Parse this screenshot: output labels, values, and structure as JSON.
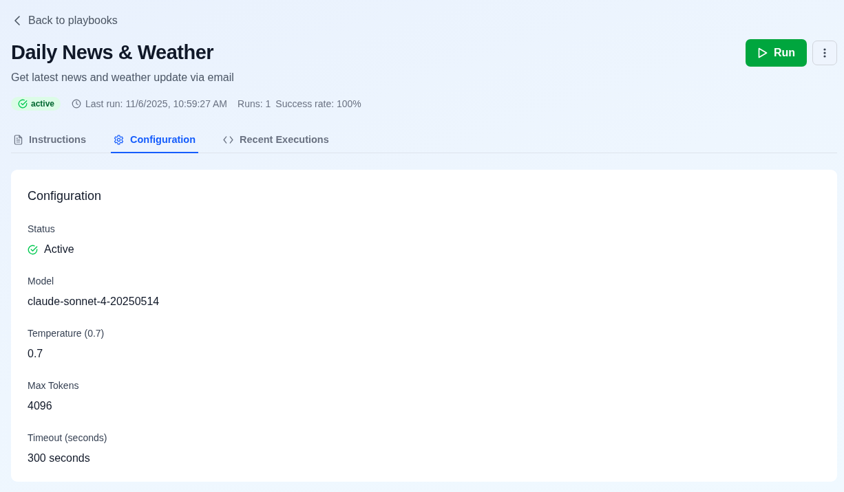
{
  "back_link": {
    "label": "Back to playbooks"
  },
  "header": {
    "title": "Daily News & Weather",
    "description": "Get latest news and weather update via email",
    "run_button": {
      "label": "Run"
    }
  },
  "meta": {
    "status": {
      "label": "active",
      "active": true
    },
    "last_run": "Last run: 11/6/2025, 10:59:27 AM",
    "runs": "Runs: 1",
    "success_rate": "Success rate: 100%"
  },
  "tabs": [
    {
      "label": "Instructions",
      "selected": false
    },
    {
      "label": "Configuration",
      "selected": true
    },
    {
      "label": "Recent Executions",
      "selected": false
    }
  ],
  "configuration": {
    "title": "Configuration",
    "fields": [
      {
        "kind": "status",
        "label": "Status",
        "value": "Active",
        "active": true
      },
      {
        "kind": "text",
        "label": "Model",
        "value": "claude-sonnet-4-20250514"
      },
      {
        "kind": "text",
        "label": "Temperature (0.7)",
        "value": "0.7"
      },
      {
        "kind": "text",
        "label": "Max Tokens",
        "value": "4096"
      },
      {
        "kind": "text",
        "label": "Timeout (seconds)",
        "value": "300 seconds"
      }
    ]
  }
}
